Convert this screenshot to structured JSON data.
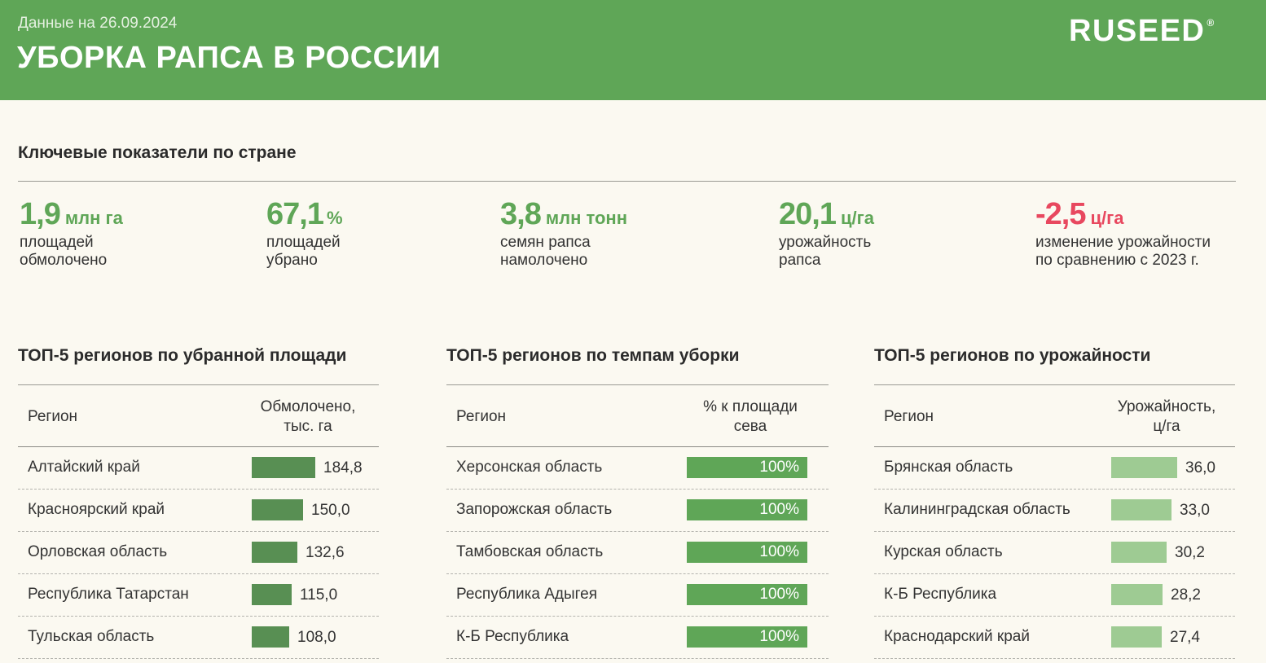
{
  "header": {
    "date_label": "Данные на 26.09.2024",
    "title": "УБОРКА РАПСА В РОССИИ",
    "logo": "RUSEED",
    "logo_mark": "®"
  },
  "colors": {
    "header_bg": "#5fa657",
    "positive": "#5fa657",
    "negative": "#e8485f",
    "bar_area": "#588f53",
    "bar_pace": "#5fa657",
    "bar_yield": "#9ecb93"
  },
  "kpi_section": {
    "title": "Ключевые показатели по стране",
    "items": [
      {
        "value": "1,9",
        "unit": "млн га",
        "line1": "площадей",
        "line2": "обмолочено"
      },
      {
        "value": "67,1",
        "unit": "%",
        "line1": "площадей",
        "line2": "убрано"
      },
      {
        "value": "3,8",
        "unit": "млн тонн",
        "line1": "семян рапса",
        "line2": "намолочено"
      },
      {
        "value": "20,1",
        "unit": "ц/га",
        "line1": "урожайность",
        "line2": "рапса"
      },
      {
        "value": "-2,5",
        "unit": "ц/га",
        "line1": "изменение урожайности",
        "line2": "по сравнению с 2023 г."
      }
    ]
  },
  "tables": [
    {
      "title": "ТОП-5 регионов по убранной площади",
      "col_region": "Регион",
      "col_metric_1": "Обмолочено,",
      "col_metric_2": "тыс. га",
      "rows": [
        {
          "region": "Алтайский край",
          "value": 184.8,
          "label": "184,8"
        },
        {
          "region": "Красноярский край",
          "value": 150.0,
          "label": "150,0"
        },
        {
          "region": "Орловская область",
          "value": 132.6,
          "label": "132,6"
        },
        {
          "region": "Республика Татарстан",
          "value": 115.0,
          "label": "115,0"
        },
        {
          "region": "Тульская область",
          "value": 108.0,
          "label": "108,0"
        }
      ]
    },
    {
      "title": "ТОП-5 регионов по темпам уборки",
      "col_region": "Регион",
      "col_metric_1": "% к площади",
      "col_metric_2": "сева",
      "rows": [
        {
          "region": "Херсонская область",
          "value": 100,
          "label": "100%"
        },
        {
          "region": "Запорожская область",
          "value": 100,
          "label": "100%"
        },
        {
          "region": "Тамбовская область",
          "value": 100,
          "label": "100%"
        },
        {
          "region": "Республика Адыгея",
          "value": 100,
          "label": "100%"
        },
        {
          "region": "К-Б Республика",
          "value": 100,
          "label": "100%"
        }
      ]
    },
    {
      "title": "ТОП-5 регионов по урожайности",
      "col_region": "Регион",
      "col_metric_1": "Урожайность,",
      "col_metric_2": "ц/га",
      "rows": [
        {
          "region": "Брянская область",
          "value": 36.0,
          "label": "36,0"
        },
        {
          "region": "Калининградская область",
          "value": 33.0,
          "label": "33,0"
        },
        {
          "region": "Курская область",
          "value": 30.2,
          "label": "30,2"
        },
        {
          "region": "К-Б Республика",
          "value": 28.2,
          "label": "28,2"
        },
        {
          "region": "Краснодарский край",
          "value": 27.4,
          "label": "27,4"
        }
      ]
    }
  ]
}
